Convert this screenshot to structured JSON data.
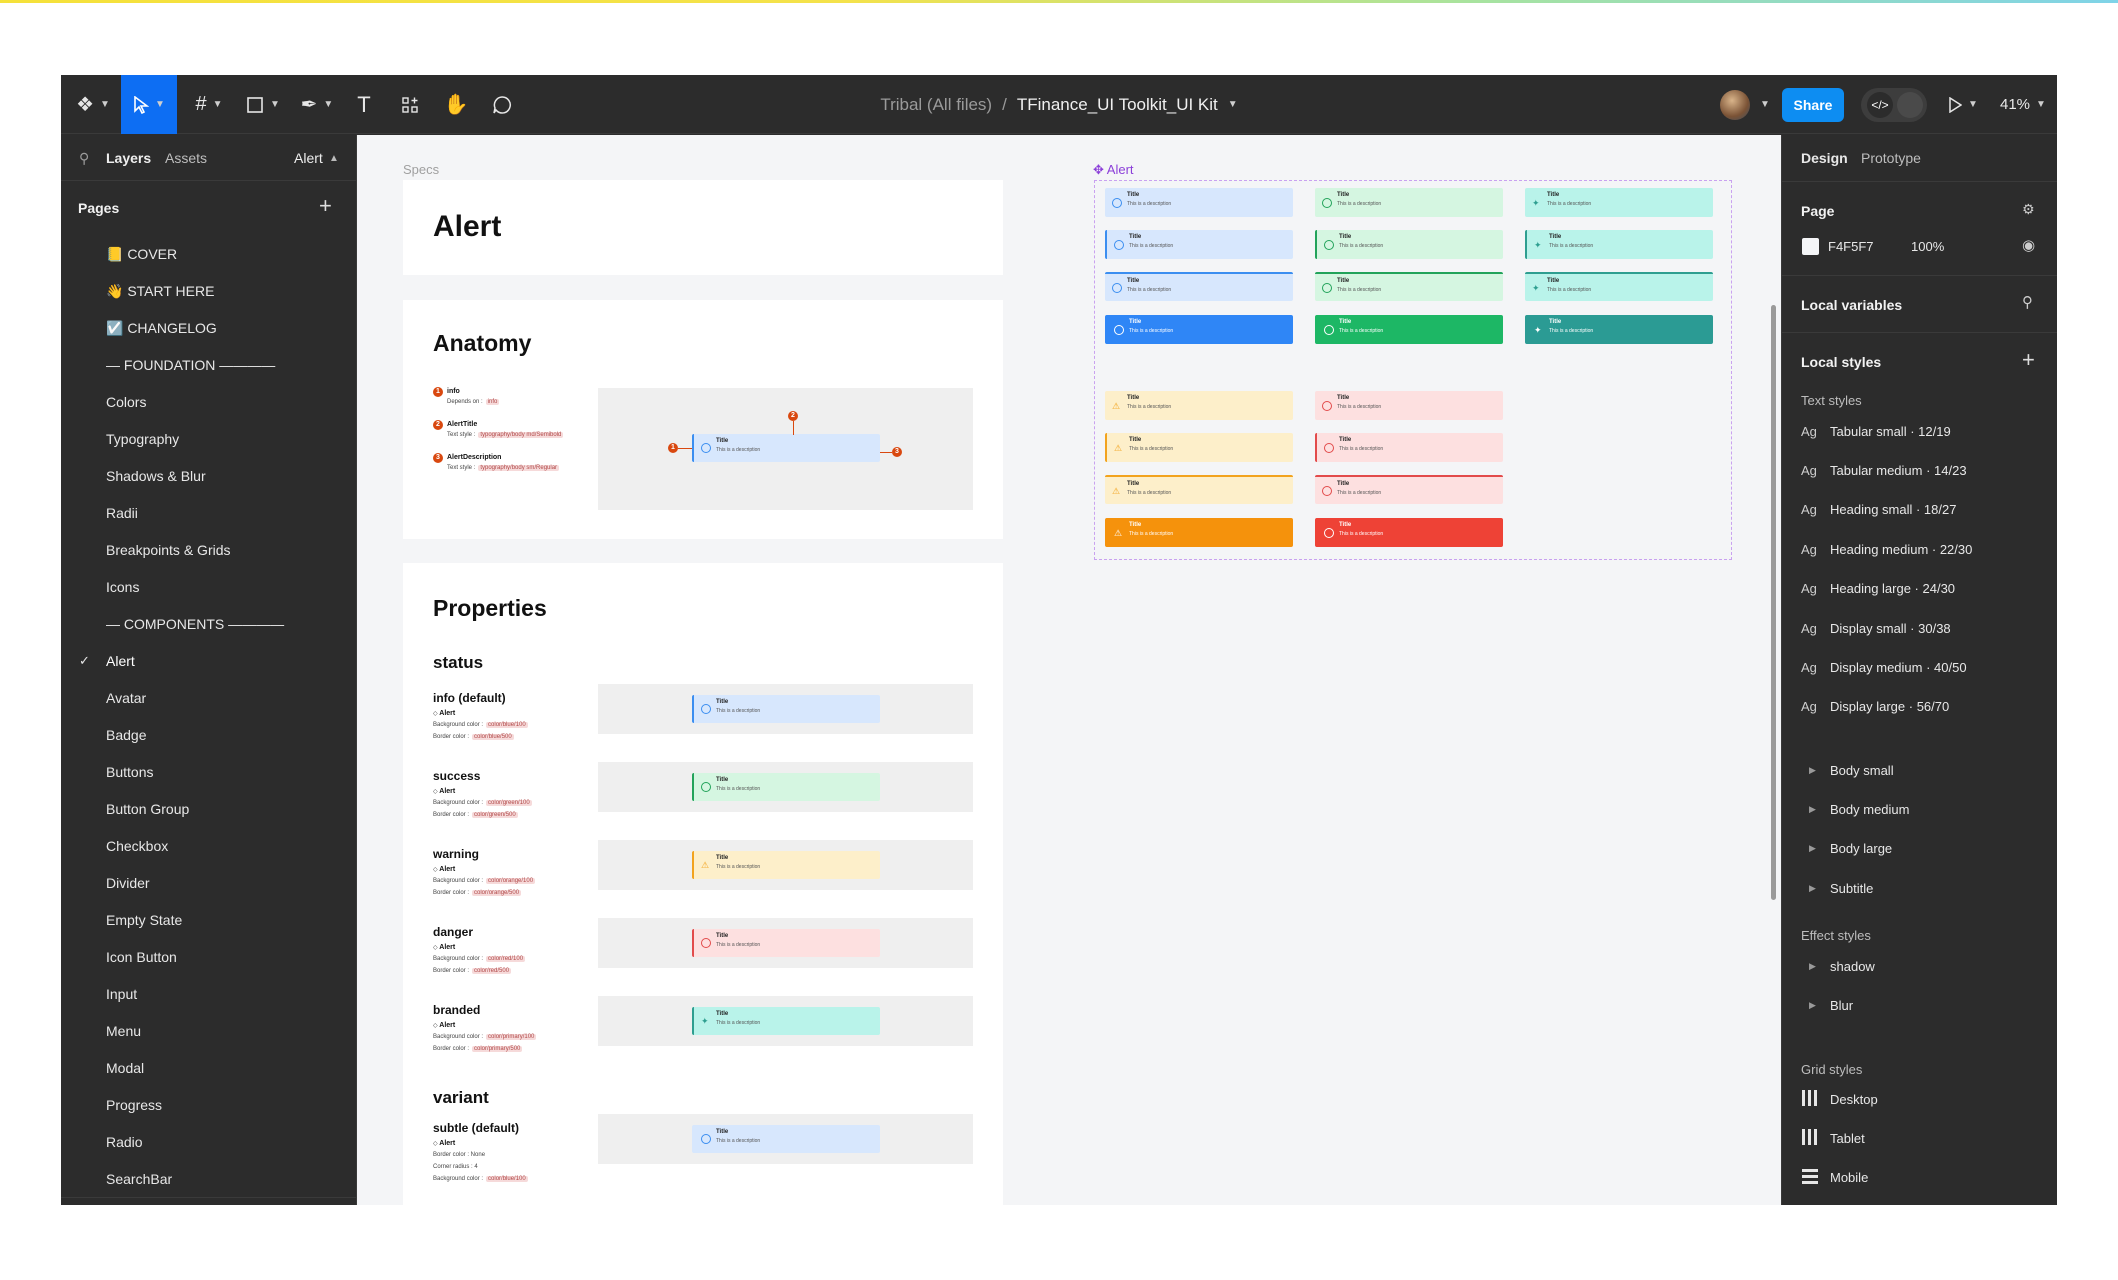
{
  "toolbar": {
    "breadcrumb_team": "Tribal (All files)",
    "breadcrumb_sep": "/",
    "file_name": "TFinance_UI Toolkit_UI Kit",
    "share_label": "Share",
    "zoom": "41%",
    "tools": [
      "main-menu",
      "move",
      "frame",
      "shape",
      "pen",
      "text",
      "resources",
      "hand",
      "comment"
    ]
  },
  "left_panel": {
    "tab_layers": "Layers",
    "tab_assets": "Assets",
    "current_page": "Alert",
    "pages_heading": "Pages",
    "pages": [
      "📒 COVER",
      "👋 START HERE",
      "☑️ CHANGELOG",
      "— FOUNDATION ————",
      "Colors",
      "Typography",
      "Shadows & Blur",
      "Radii",
      "Breakpoints & Grids",
      "Icons",
      "— COMPONENTS ————",
      "Alert",
      "Avatar",
      "Badge",
      "Buttons",
      "Button Group",
      "Checkbox",
      "Divider",
      "Empty State",
      "Icon Button",
      "Input",
      "Menu",
      "Modal",
      "Progress",
      "Radio",
      "SearchBar"
    ],
    "selected_page": "Alert"
  },
  "canvas": {
    "specs_label": "Specs",
    "frame_label": "Alert",
    "title": "Alert",
    "anatomy_heading": "Anatomy",
    "anatomy": [
      {
        "n": "1",
        "name": "info",
        "detail": "Depends on :",
        "token": "info"
      },
      {
        "n": "2",
        "name": "AlertTitle",
        "detail": "Text style :",
        "token": "typography/body md/Semibold"
      },
      {
        "n": "3",
        "name": "AlertDescription",
        "detail": "Text style :",
        "token": "typography/body sm/Regular"
      }
    ],
    "properties_heading": "Properties",
    "status_heading": "status",
    "statuses": [
      {
        "name": "info (default)",
        "component": "Alert",
        "bg_label": "Background color :",
        "bg_token": "color/blue/100",
        "border_label": "Border color :",
        "border_token": "color/blue/500"
      },
      {
        "name": "success",
        "component": "Alert",
        "bg_label": "Background color :",
        "bg_token": "color/green/100",
        "border_label": "Border color :",
        "border_token": "color/green/500"
      },
      {
        "name": "warning",
        "component": "Alert",
        "bg_label": "Background color :",
        "bg_token": "color/orange/100",
        "border_label": "Border color :",
        "border_token": "color/orange/500"
      },
      {
        "name": "danger",
        "component": "Alert",
        "bg_label": "Background color :",
        "bg_token": "color/red/100",
        "border_label": "Border color :",
        "border_token": "color/red/500"
      },
      {
        "name": "branded",
        "component": "Alert",
        "bg_label": "Background color :",
        "bg_token": "color/primary/100",
        "border_label": "Border color :",
        "border_token": "color/primary/500"
      }
    ],
    "variant_heading": "variant",
    "variant": {
      "name": "subtle (default)",
      "component": "Alert",
      "line1": "Border color : None",
      "line2": "Corner radius : 4",
      "bg_label": "Background color :",
      "bg_token": "color/blue/100"
    },
    "alert_title": "Title",
    "alert_description": "This is a description",
    "colors": {
      "info_bg": "#d7e7fd",
      "info_border": "#3b8ef0",
      "info_solid": "#2f86f6",
      "success_bg": "#d5f6e1",
      "success_border": "#22a35a",
      "success_solid": "#1db765",
      "branded_bg": "#b9f3ea",
      "branded_border": "#2e9e90",
      "branded_solid": "#2b9b94",
      "warning_bg": "#fdefca",
      "warning_border": "#f2a31e",
      "warning_solid": "#f5920c",
      "danger_bg": "#fde0e0",
      "danger_border": "#e24b4b",
      "danger_solid": "#ee4236"
    }
  },
  "right_panel": {
    "tab_design": "Design",
    "tab_prototype": "Prototype",
    "page_heading": "Page",
    "page_color": "F4F5F7",
    "page_opacity": "100%",
    "local_variables": "Local variables",
    "local_styles": "Local styles",
    "text_styles_heading": "Text styles",
    "text_styles": [
      {
        "icon": "Ag",
        "name": "Tabular small · 12/19"
      },
      {
        "icon": "Ag",
        "name": "Tabular medium · 14/23"
      },
      {
        "icon": "Ag",
        "name": "Heading small · 18/27"
      },
      {
        "icon": "Ag",
        "name": "Heading medium · 22/30"
      },
      {
        "icon": "Ag",
        "name": "Heading large · 24/30"
      },
      {
        "icon": "Ag",
        "name": "Display small · 30/38"
      },
      {
        "icon": "Ag",
        "name": "Display medium · 40/50"
      },
      {
        "icon": "Ag",
        "name": "Display large · 56/70"
      }
    ],
    "text_groups": [
      "Body small",
      "Body medium",
      "Body large",
      "Subtitle"
    ],
    "effect_styles_heading": "Effect styles",
    "effect_styles": [
      "shadow",
      "Blur"
    ],
    "grid_styles_heading": "Grid styles",
    "grid_styles": [
      "Desktop",
      "Tablet",
      "Mobile"
    ]
  }
}
